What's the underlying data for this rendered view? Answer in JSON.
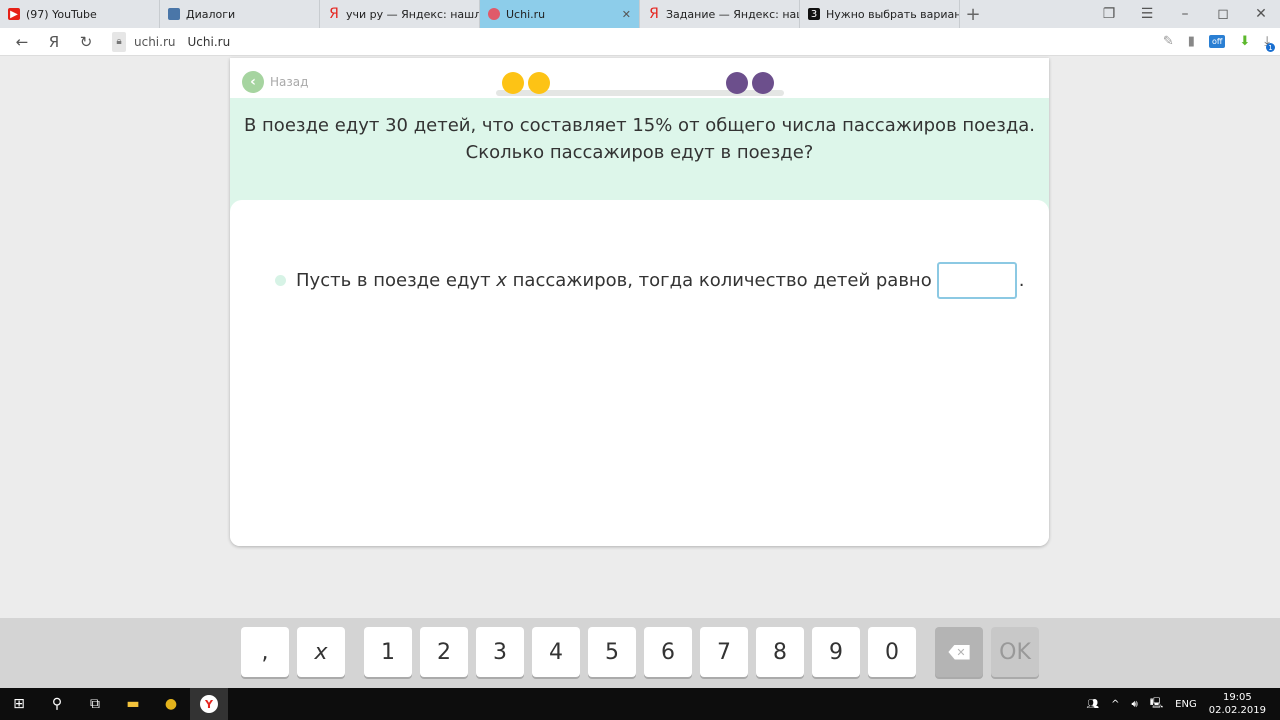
{
  "browser": {
    "tabs": [
      {
        "label": "(97) YouTube",
        "icon": "youtube-icon",
        "color": "#e62117"
      },
      {
        "label": "Диалоги",
        "icon": "vk-icon",
        "color": "#4a76a8"
      },
      {
        "label": "учи ру — Яндекс: нашлось",
        "icon": "yandex-icon",
        "color": "#e52620"
      },
      {
        "label": "Uchi.ru",
        "icon": "uchi-icon",
        "color": "#e05a6a"
      },
      {
        "label": "Задание — Яндекс: нашлось",
        "icon": "yandex-icon",
        "color": "#e52620"
      },
      {
        "label": "Нужно выбрать вариант о",
        "icon": "znanija-icon",
        "color": "#111111"
      }
    ],
    "new_tab": "+",
    "url_domain": "uchi.ru",
    "page_title": "Uchi.ru",
    "download_badge": "1"
  },
  "lesson": {
    "back_label": "Назад",
    "question_line1": "В поезде едут 30 детей, что составляет 15% от общего числа пассажиров поезда.",
    "question_line2": "Сколько пассажиров едут в поезде?",
    "step_before": "Пусть в поезде едут ",
    "step_var": "x",
    "step_after": " пассажиров, тогда количество детей равно",
    "step_end": ".",
    "answer_value": "",
    "progress_colors": {
      "done": "#fdc315",
      "todo": "#6c4f8c"
    }
  },
  "keyboard": {
    "keys": [
      ",",
      "x",
      "1",
      "2",
      "3",
      "4",
      "5",
      "6",
      "7",
      "8",
      "9",
      "0"
    ],
    "ok": "OK"
  },
  "taskbar": {
    "lang": "ENG",
    "time": "19:05",
    "date": "02.02.2019"
  }
}
